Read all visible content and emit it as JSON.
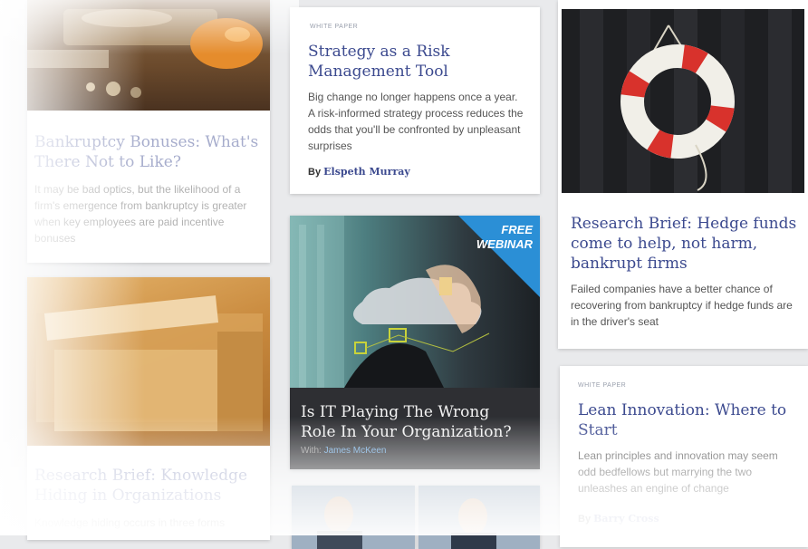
{
  "cards": {
    "bankruptcy": {
      "title": "Bankruptcy Bonuses: What's There Not to Like?",
      "body": "It may be bad optics, but the likelihood of a firm's emergence from bankruptcy is greater when key employees are paid incentive bonuses"
    },
    "strategy": {
      "kicker": "WHITE PAPER",
      "title": "Strategy as a Risk Management Tool",
      "body": "Big change no longer happens once a year. A risk-informed strategy process reduces the odds that you'll be confronted by unpleasant surprises",
      "by_label": "By",
      "author": "Elspeth Murray"
    },
    "hedge": {
      "title": "Research Brief: Hedge funds come to help, not harm, bankrupt firms",
      "body": "Failed companies have a better chance of recovering from bankruptcy if hedge funds are in the driver's seat"
    },
    "webinar": {
      "banner_line1": "FREE",
      "banner_line2": "WEBINAR",
      "title": "Is IT Playing The Wrong Role In Your Organization?",
      "with_label": "With:",
      "presenter": "James McKeen"
    },
    "knowledge": {
      "title": "Research Brief: Knowledge Hiding in Organizations",
      "body": "Knowledge hiding occurs in three forms"
    },
    "lean": {
      "kicker": "WHITE PAPER",
      "title": "Lean Innovation: Where to Start",
      "body": "Lean principles and innovation may seem odd bedfellows but marrying the two unleashes an engine of change",
      "by_label": "By",
      "author": "Barry Cross"
    }
  },
  "colors": {
    "title_blue": "#3c4a8f",
    "banner_blue": "#2b8fd6",
    "author_link": "#6fa8dc"
  }
}
